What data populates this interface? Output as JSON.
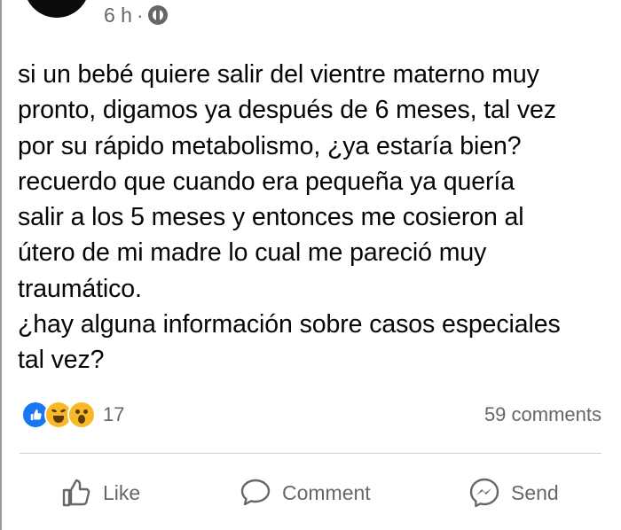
{
  "post": {
    "timestamp": "6 h",
    "separator": "·",
    "audience_icon": "globe-icon",
    "text": "si un bebé quiere salir del vientre materno muy\npronto, digamos ya después de 6 meses, tal vez\npor su rápido metabolismo, ¿ya estaría bien?\nrecuerdo que cuando era pequeña ya quería\nsalir a los 5 meses y entonces me cosieron al\nútero de mi madre lo cual me pareció muy\ntraumático.\n¿hay alguna información sobre casos especiales\ntal vez?"
  },
  "stats": {
    "reactions": [
      "like-reaction-icon",
      "haha-reaction-icon",
      "wow-reaction-icon"
    ],
    "reaction_count": "17",
    "comments": "59 comments"
  },
  "actions": {
    "like_label": "Like",
    "comment_label": "Comment",
    "send_label": "Send"
  },
  "colors": {
    "text": "#050505",
    "secondary": "#65676b",
    "like_blue": "#1877f2",
    "reaction_yellow": "#f7b928",
    "divider": "#ced0d4"
  }
}
